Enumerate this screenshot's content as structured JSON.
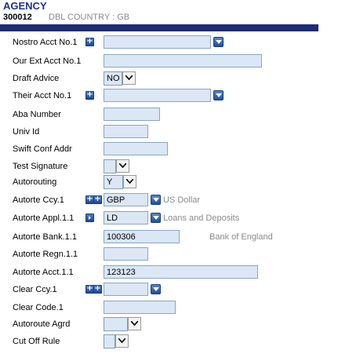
{
  "header": {
    "title": "AGENCY",
    "record_id": "300012",
    "country_label": "DBL COUNTRY : GB"
  },
  "fields": {
    "nostro_acct_no": {
      "label": "Nostro Acct No.1",
      "value": ""
    },
    "our_ext_acct_no": {
      "label": "Our Ext Acct No.1",
      "value": ""
    },
    "draft_advice": {
      "label": "Draft Advice",
      "value": "NO"
    },
    "their_acct_no": {
      "label": "Their Acct No.1",
      "value": ""
    },
    "aba_number": {
      "label": "Aba Number",
      "value": ""
    },
    "univ_id": {
      "label": "Univ Id",
      "value": ""
    },
    "swift_conf_addr": {
      "label": "Swift Conf Addr",
      "value": ""
    },
    "test_signature": {
      "label": "Test Signature",
      "value": ""
    },
    "autorouting": {
      "label": "Autorouting",
      "value": "Y"
    },
    "autorte_ccy": {
      "label": "Autorte Ccy.1",
      "value": "GBP",
      "enrichment": "US Dollar"
    },
    "autorte_appl": {
      "label": "Autorte Appl.1.1",
      "value": "LD",
      "enrichment": "Loans and Deposits"
    },
    "autorte_bank": {
      "label": "Autorte Bank.1.1",
      "value": "100306",
      "enrichment": "Bank of England"
    },
    "autorte_regn": {
      "label": "Autorte Regn.1.1",
      "value": ""
    },
    "autorte_acct": {
      "label": "Autorte Acct.1.1",
      "value": "123123"
    },
    "clear_ccy": {
      "label": "Clear Ccy.1",
      "value": ""
    },
    "clear_code": {
      "label": "Clear Code.1",
      "value": ""
    },
    "autoroute_agrd": {
      "label": "Autoroute Agrd",
      "value": ""
    },
    "cut_off_rule": {
      "label": "Cut Off Rule",
      "value": ""
    }
  },
  "icons": {
    "expand": "plus-icon",
    "expand_pair": "plus-plus-icon",
    "navigate": "right-arrow-icon",
    "dropdown": "chevron-down-icon"
  },
  "colors": {
    "title": "#21318c",
    "header_bar": "#1f2c73",
    "input_bg": "#dbe7f4",
    "enrichment_text": "#8a8a8a"
  }
}
